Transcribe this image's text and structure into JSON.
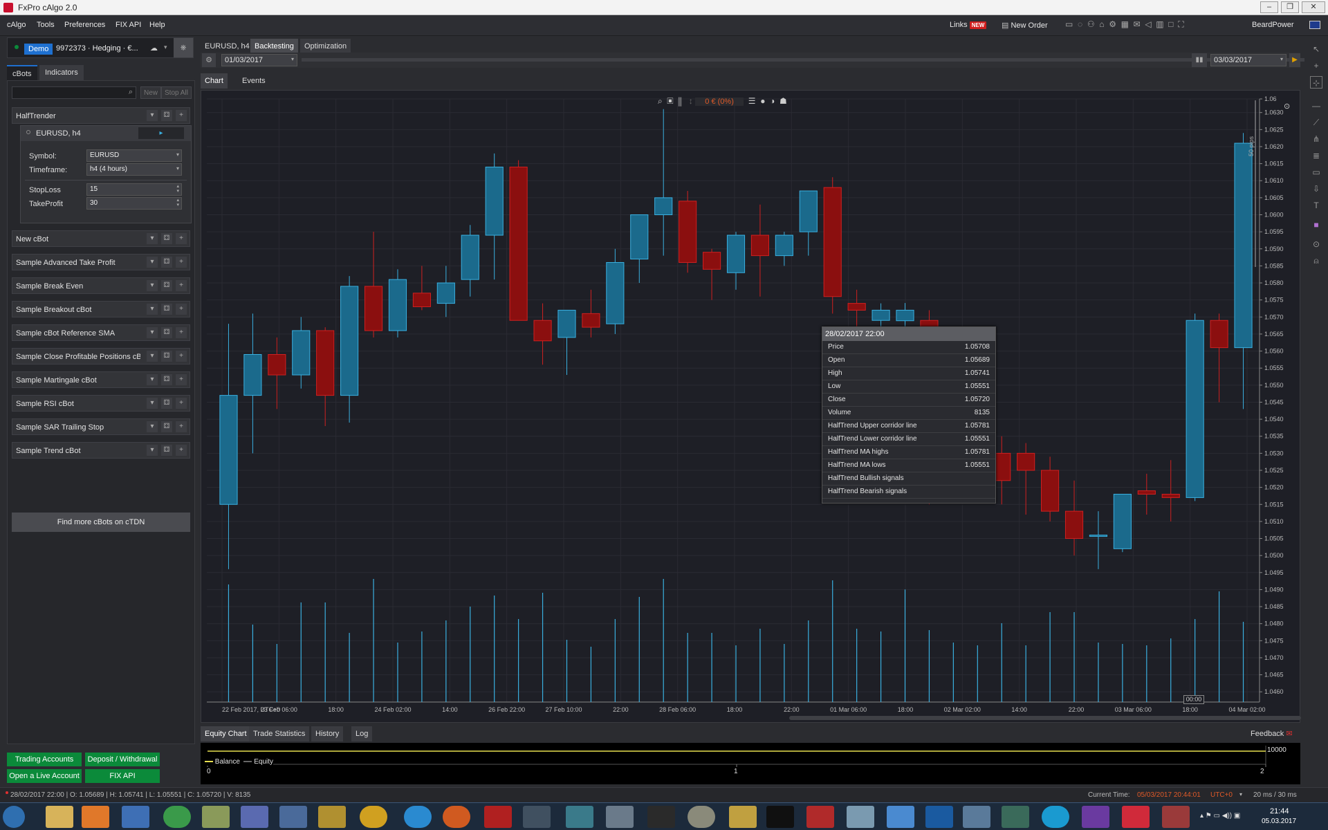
{
  "window": {
    "title": "FxPro cAlgo 2.0"
  },
  "menu": [
    "cAlgo",
    "Tools",
    "Preferences",
    "FIX API",
    "Help"
  ],
  "header": {
    "links": "Links",
    "new_badge": "NEW",
    "new_order": "New Order",
    "user": "BeardPower"
  },
  "account": {
    "mode": "Demo",
    "number": "9972373 · Hedging · €..."
  },
  "left_tabs": [
    "cBots",
    "Indicators"
  ],
  "left_buttons": {
    "new": "New",
    "stop_all": "Stop All"
  },
  "active_bot": {
    "name": "HalfTrender",
    "instance": "EURUSD, h4",
    "params": [
      {
        "label": "Symbol:",
        "value": "EURUSD"
      },
      {
        "label": "Timeframe:",
        "value": "h4 (4 hours)"
      },
      {
        "label": "StopLoss",
        "value": "15"
      },
      {
        "label": "TakeProfit",
        "value": "30"
      }
    ]
  },
  "bots": [
    "New cBot",
    "Sample Advanced Take Profit",
    "Sample Break Even",
    "Sample Breakout cBot",
    "Sample cBot Reference SMA",
    "Sample Close Profitable Positions cB",
    "Sample Martingale cBot",
    "Sample RSI cBot",
    "Sample SAR Trailing Stop",
    "Sample Trend cBot"
  ],
  "find_more": "Find more cBots on cTDN",
  "bottom_buttons": {
    "trading_accounts": "Trading Accounts",
    "deposit": "Deposit / Withdrawal",
    "open_live": "Open a Live Account",
    "fix_api": "FIX API"
  },
  "main_tabs": [
    "EURUSD, h4",
    "Backtesting",
    "Optimization"
  ],
  "backtest": {
    "start": "01/03/2017",
    "end": "03/03/2017"
  },
  "chart_tabs": [
    "Chart",
    "Events"
  ],
  "pnl": "0 € (0%)",
  "pips_label": "50 pips",
  "tooltip": {
    "time": "28/02/2017 22:00",
    "rows": [
      {
        "k": "Price",
        "v": "1.05708"
      },
      {
        "k": "Open",
        "v": "1.05689"
      },
      {
        "k": "High",
        "v": "1.05741"
      },
      {
        "k": "Low",
        "v": "1.05551"
      },
      {
        "k": "Close",
        "v": "1.05720"
      },
      {
        "k": "Volume",
        "v": "8135"
      },
      {
        "k": "HalfTrend Upper corridor line",
        "v": "1.05781"
      },
      {
        "k": "HalfTrend Lower corridor line",
        "v": "1.05551"
      },
      {
        "k": "HalfTrend MA highs",
        "v": "1.05781"
      },
      {
        "k": "HalfTrend MA lows",
        "v": "1.05551"
      },
      {
        "k": "HalfTrend Bullish signals",
        "v": ""
      },
      {
        "k": "HalfTrend Bearish signals",
        "v": ""
      }
    ]
  },
  "bottom_tabs": [
    "Equity Chart",
    "Trade Statistics",
    "History",
    "Log"
  ],
  "feedback": "Feedback",
  "equity": {
    "legend_balance": "Balance",
    "legend_equity": "Equity",
    "level": "10000",
    "x0": "0",
    "x1": "1",
    "x2": "2"
  },
  "status": {
    "ohlc": "28/02/2017 22:00 | O: 1.05689 | H: 1.05741 | L: 1.05551 | C: 1.05720 | V: 8135",
    "current_label": "Current Time:",
    "current": "05/03/2017 20:44:01",
    "tz": "UTC+0",
    "latency": "20 ms / 30 ms"
  },
  "clock": {
    "time": "21:44",
    "date": "05.03.2017"
  },
  "colors": {
    "bull": "#1b6a8c",
    "bull_edge": "#3ab0e0",
    "bear": "#8b0f0f",
    "bear_edge": "#d02020",
    "accent": "#1e70d0"
  },
  "chart_data": {
    "type": "candlestick",
    "x_labels": [
      "22 Feb 2017, UTC+0",
      "23 Feb 06:00",
      "18:00",
      "24 Feb 02:00",
      "14:00",
      "26 Feb 22:00",
      "27 Feb 10:00",
      "22:00",
      "28 Feb 06:00",
      "18:00",
      "22:00",
      "01 Mar 06:00",
      "18:00",
      "02 Mar 02:00",
      "14:00",
      "22:00",
      "03 Mar 06:00",
      "18:00",
      "04 Mar 02:00"
    ],
    "crosshair_label": "00:00",
    "y_ticks": [
      "1.06",
      "1.0630",
      "1.0625",
      "1.0620",
      "1.0615",
      "1.0610",
      "1.0605",
      "1.0600",
      "1.0595",
      "1.0590",
      "1.0585",
      "1.0580",
      "1.0575",
      "1.0570",
      "1.0565",
      "1.0560",
      "1.0555",
      "1.0550",
      "1.0545",
      "1.0540",
      "1.0535",
      "1.0530",
      "1.0525",
      "1.0520",
      "1.0515",
      "1.0510",
      "1.0505",
      "1.0500",
      "1.0495",
      "1.0490",
      "1.0485",
      "1.0480",
      "1.0475",
      "1.0470",
      "1.0465",
      "1.0460"
    ],
    "ylim": [
      1.0457,
      1.0634
    ],
    "candles": [
      {
        "o": 1.0515,
        "h": 1.0568,
        "l": 1.0496,
        "c": 1.0547
      },
      {
        "o": 1.0547,
        "h": 1.0571,
        "l": 1.053,
        "c": 1.0559
      },
      {
        "o": 1.0559,
        "h": 1.0564,
        "l": 1.0543,
        "c": 1.0553
      },
      {
        "o": 1.0553,
        "h": 1.057,
        "l": 1.0549,
        "c": 1.0566
      },
      {
        "o": 1.0566,
        "h": 1.0567,
        "l": 1.0538,
        "c": 1.0547
      },
      {
        "o": 1.0547,
        "h": 1.0582,
        "l": 1.0539,
        "c": 1.0579
      },
      {
        "o": 1.0579,
        "h": 1.0595,
        "l": 1.0564,
        "c": 1.0566
      },
      {
        "o": 1.0566,
        "h": 1.0584,
        "l": 1.0564,
        "c": 1.0581
      },
      {
        "o": 1.0577,
        "h": 1.0585,
        "l": 1.0572,
        "c": 1.0573
      },
      {
        "o": 1.0574,
        "h": 1.0585,
        "l": 1.057,
        "c": 1.058
      },
      {
        "o": 1.0581,
        "h": 1.0597,
        "l": 1.0576,
        "c": 1.0594
      },
      {
        "o": 1.0594,
        "h": 1.0618,
        "l": 1.0581,
        "c": 1.0614
      },
      {
        "o": 1.0614,
        "h": 1.0616,
        "l": 1.0569,
        "c": 1.0569
      },
      {
        "o": 1.0569,
        "h": 1.0574,
        "l": 1.0556,
        "c": 1.0563
      },
      {
        "o": 1.0564,
        "h": 1.0572,
        "l": 1.0553,
        "c": 1.0572
      },
      {
        "o": 1.0571,
        "h": 1.0578,
        "l": 1.0564,
        "c": 1.0567
      },
      {
        "o": 1.0568,
        "h": 1.059,
        "l": 1.0565,
        "c": 1.0586
      },
      {
        "o": 1.0587,
        "h": 1.06,
        "l": 1.058,
        "c": 1.06
      },
      {
        "o": 1.06,
        "h": 1.0631,
        "l": 1.0588,
        "c": 1.0605
      },
      {
        "o": 1.0604,
        "h": 1.0607,
        "l": 1.0583,
        "c": 1.0586
      },
      {
        "o": 1.0589,
        "h": 1.059,
        "l": 1.0575,
        "c": 1.0584
      },
      {
        "o": 1.0583,
        "h": 1.0595,
        "l": 1.0578,
        "c": 1.0594
      },
      {
        "o": 1.0594,
        "h": 1.0603,
        "l": 1.0576,
        "c": 1.0588
      },
      {
        "o": 1.0588,
        "h": 1.0595,
        "l": 1.0585,
        "c": 1.0594
      },
      {
        "o": 1.0595,
        "h": 1.0607,
        "l": 1.0588,
        "c": 1.0607
      },
      {
        "o": 1.0608,
        "h": 1.0611,
        "l": 1.0571,
        "c": 1.0576
      },
      {
        "o": 1.0574,
        "h": 1.0578,
        "l": 1.0555,
        "c": 1.0572
      },
      {
        "o": 1.0569,
        "h": 1.0574,
        "l": 1.0555,
        "c": 1.0572
      },
      {
        "o": 1.05689,
        "h": 1.05741,
        "l": 1.05551,
        "c": 1.0572
      },
      {
        "o": 1.0569,
        "h": 1.0572,
        "l": 1.0515,
        "c": 1.052
      },
      {
        "o": 1.052,
        "h": 1.0535,
        "l": 1.0516,
        "c": 1.053
      },
      {
        "o": 1.053,
        "h": 1.0538,
        "l": 1.052,
        "c": 1.053
      },
      {
        "o": 1.053,
        "h": 1.0535,
        "l": 1.0515,
        "c": 1.0522
      },
      {
        "o": 1.053,
        "h": 1.0533,
        "l": 1.0512,
        "c": 1.0525
      },
      {
        "o": 1.0525,
        "h": 1.0529,
        "l": 1.051,
        "c": 1.0513
      },
      {
        "o": 1.0513,
        "h": 1.0522,
        "l": 1.05,
        "c": 1.0505
      },
      {
        "o": 1.0506,
        "h": 1.0513,
        "l": 1.0496,
        "c": 1.0506
      },
      {
        "o": 1.0502,
        "h": 1.0518,
        "l": 1.0501,
        "c": 1.0518
      },
      {
        "o": 1.0519,
        "h": 1.0524,
        "l": 1.0512,
        "c": 1.0518
      },
      {
        "o": 1.0518,
        "h": 1.0528,
        "l": 1.051,
        "c": 1.0517
      },
      {
        "o": 1.0517,
        "h": 1.0571,
        "l": 1.0516,
        "c": 1.0569
      },
      {
        "o": 1.0569,
        "h": 1.0571,
        "l": 1.0545,
        "c": 1.0561
      },
      {
        "o": 1.0561,
        "h": 1.0624,
        "l": 1.0543,
        "c": 1.0621
      }
    ],
    "volume": [
      8500,
      5600,
      4200,
      7200,
      7200,
      5000,
      8900,
      4300,
      5100,
      5900,
      6900,
      7700,
      6000,
      7900,
      4500,
      4000,
      6000,
      7600,
      8900,
      5000,
      5000,
      4100,
      5300,
      4200,
      5900,
      8800,
      5300,
      5100,
      8135,
      5200,
      4300,
      4100,
      5700,
      4100,
      6500,
      6500,
      4300,
      4200,
      4100,
      4600,
      6000,
      8000,
      5800
    ],
    "equity": {
      "balance": [
        10000,
        10000,
        10000
      ],
      "x": [
        0,
        1,
        2
      ],
      "level": 10000
    }
  }
}
